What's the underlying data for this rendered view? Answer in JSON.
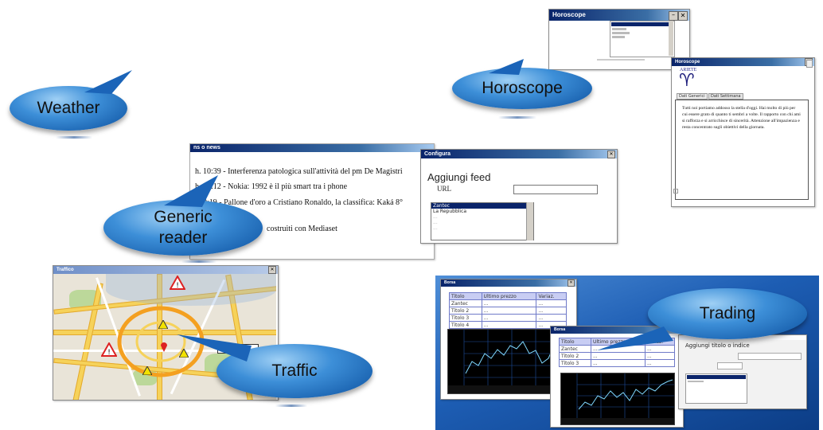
{
  "bubbles": {
    "weather": "Weather",
    "horoscope": "Horoscope",
    "generic_reader": [
      "Generic",
      "reader"
    ],
    "traffic": "Traffic",
    "trading": "Trading"
  },
  "reader": {
    "title": "ns o news",
    "lines": [
      "h. 10:39 -  Interferenza patologica sull'attività del pm De Magistri",
      "h. 10:12 -  Nokia: 1992 è il più smart tra i phone",
      "h. 9:19 -  Pallone d'oro a Cristiano Ronaldo, la classifica: Kaká 8°",
      "costruiti con Mediaset"
    ]
  },
  "configure": {
    "title": "Configura",
    "heading": "Aggiungi feed",
    "url_label": "URL",
    "feeds": [
      "Zantec",
      "La Repubblica",
      "...",
      "...",
      "..."
    ]
  },
  "horoscope": {
    "list_title": "Horoscope",
    "sign_title": "Horoscope",
    "sign_name": "ARIETE",
    "sign_glyph": "♈",
    "tabs": [
      "Dati Generici",
      "Dati Settimana"
    ],
    "text": "Tutti noi portiamo addosso la stella d'oggi. Hai molto di più per cui essere grato di quanto ti sembri a volte. Il rapporto con chi ami si rafforza e si arricchisce di sincerità. Attenzione all'impazienza e resta concentrato sugli obiettivi della giornata."
  },
  "traffic": {
    "title": "Traffico"
  },
  "trading": {
    "title": "Borsa",
    "add_label": "Aggiungi titolo o indice",
    "headers": [
      "Titolo",
      "Ultimo prezzo",
      "Variaz."
    ],
    "rows": [
      [
        "Zantec",
        "...",
        "..."
      ],
      [
        "Titolo 2",
        "...",
        "..."
      ],
      [
        "Titolo 3",
        "...",
        "..."
      ],
      [
        "Titolo 4",
        "...",
        "..."
      ]
    ]
  },
  "colors": {
    "bubble_dark": "#0b4f9e",
    "bubble_light": "#9fd0f5",
    "title_bar": "#0a246a",
    "desktop_blue": "#1d5db3",
    "chart_line": "#7fd8ff"
  }
}
